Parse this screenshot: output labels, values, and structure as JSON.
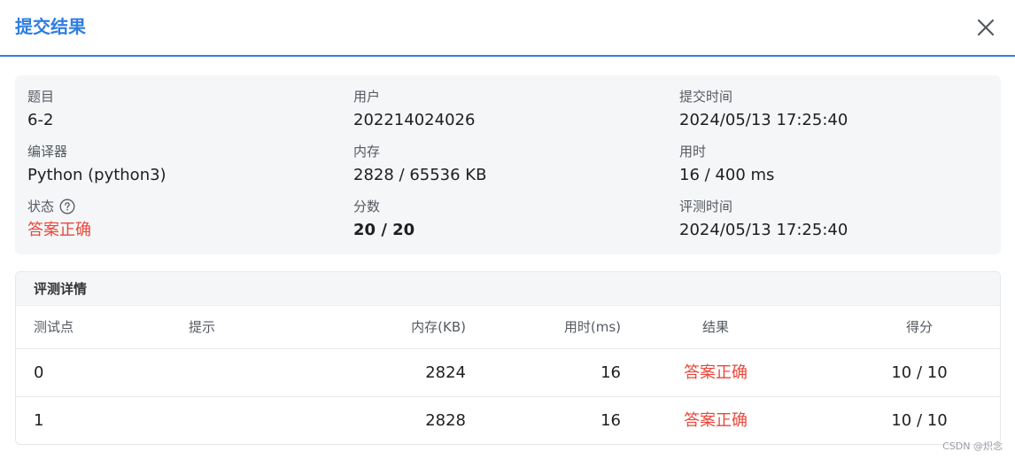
{
  "dialog": {
    "title": "提交结果"
  },
  "info": {
    "problem_label": "题目",
    "problem_value": "6-2",
    "user_label": "用户",
    "user_value": "202214024026",
    "submit_time_label": "提交时间",
    "submit_time_value": "2024/05/13 17:25:40",
    "compiler_label": "编译器",
    "compiler_value": "Python (python3)",
    "memory_label": "内存",
    "memory_value": "2828 / 65536 KB",
    "time_label": "用时",
    "time_value": "16 / 400 ms",
    "status_label": "状态",
    "status_value": "答案正确",
    "score_label": "分数",
    "score_value": "20 / 20",
    "judge_time_label": "评测时间",
    "judge_time_value": "2024/05/13 17:25:40"
  },
  "details": {
    "title": "评测详情",
    "columns": {
      "case": "测试点",
      "hint": "提示",
      "memory": "内存(KB)",
      "time": "用时(ms)",
      "result": "结果",
      "score": "得分"
    },
    "rows": [
      {
        "case": "0",
        "hint": "",
        "memory": "2824",
        "time": "16",
        "result": "答案正确",
        "score": "10 / 10"
      },
      {
        "case": "1",
        "hint": "",
        "memory": "2828",
        "time": "16",
        "result": "答案正确",
        "score": "10 / 10"
      }
    ]
  },
  "watermark": "CSDN @炽念",
  "icons": {
    "close": "close-icon",
    "help": "question-circle-icon"
  },
  "colors": {
    "accent": "#2f7ee0",
    "accepted": "#e8483b",
    "panel_bg": "#f5f6f8"
  }
}
